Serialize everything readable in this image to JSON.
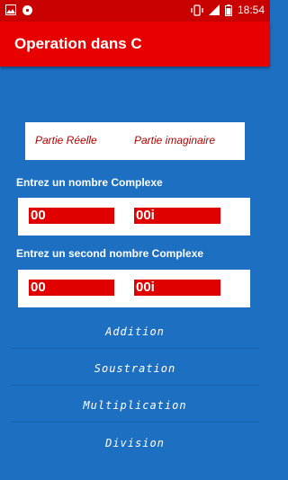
{
  "status_bar": {
    "time": "18:54",
    "icons": [
      "image-icon",
      "cd-icon",
      "vibrate-icon",
      "signal-icon",
      "battery-icon"
    ]
  },
  "app_bar": {
    "title": "Operation dans C"
  },
  "header": {
    "real_label": "Partie Réelle",
    "imag_label": "Partie imaginaire"
  },
  "first": {
    "label": "Entrez un nombre Complexe",
    "real_value": "00",
    "imag_value": "00i"
  },
  "second": {
    "label": "Entrez un second nombre Complexe",
    "real_value": "00",
    "imag_value": "00i"
  },
  "operations": {
    "addition": "Addition",
    "soustraction": "Soustration",
    "multiplication": "Multiplication",
    "division": "Division"
  },
  "colors": {
    "primary": "#e80000",
    "status": "#c80000",
    "background": "#1d6fc2",
    "field": "#e00000"
  }
}
